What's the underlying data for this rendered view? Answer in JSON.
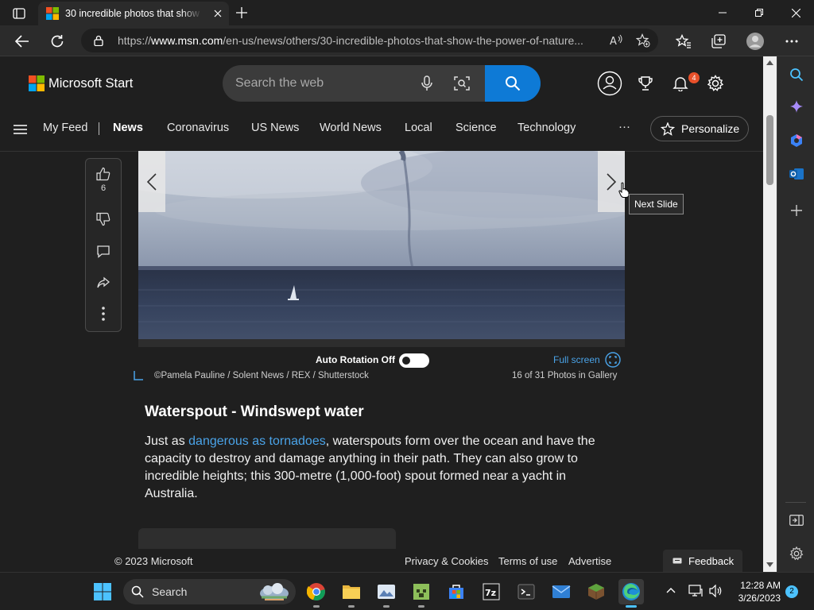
{
  "browser": {
    "tab_title": "30 incredible photos that show the power of nature",
    "url_prefix": "https://",
    "url_host": "www.msn.com",
    "url_path": "/en-us/news/others/30-incredible-photos-that-show-the-power-of-nature..."
  },
  "header": {
    "brand": "Microsoft Start",
    "search_placeholder": "Search the web",
    "notification_count": "4"
  },
  "nav": {
    "items": [
      "My Feed",
      "News",
      "Coronavirus",
      "US News",
      "World News",
      "Local",
      "Science",
      "Technology"
    ],
    "more": "···",
    "personalize": "Personalize"
  },
  "actions": {
    "like_count": "6"
  },
  "slide": {
    "tooltip": "Next Slide",
    "auto_rotation_label": "Auto Rotation Off",
    "fullscreen_label": "Full screen",
    "credit": "©Pamela Pauline / Solent News / REX / Shutterstock",
    "count": "16 of 31 Photos in Gallery"
  },
  "article": {
    "title": "Waterspout - Windswept water",
    "body_before": "Just as ",
    "body_link": "dangerous as tornadoes",
    "body_after": ", waterspouts form over the ocean and have the capacity to destroy and damage anything in their path. They can also grow to incredible heights; this 300-metre (1,000-foot) spout formed near a yacht in Australia."
  },
  "footer": {
    "copyright": "© 2023 Microsoft",
    "privacy": "Privacy & Cookies",
    "terms": "Terms of use",
    "advertise": "Advertise",
    "feedback": "Feedback"
  },
  "taskbar": {
    "search_label": "Search",
    "time": "12:28 AM",
    "date": "3/26/2023",
    "notification_count": "2"
  },
  "colors": {
    "accent_blue": "#0e7ad6",
    "link_blue": "#4aa3e8",
    "badge_orange": "#e8502a"
  }
}
